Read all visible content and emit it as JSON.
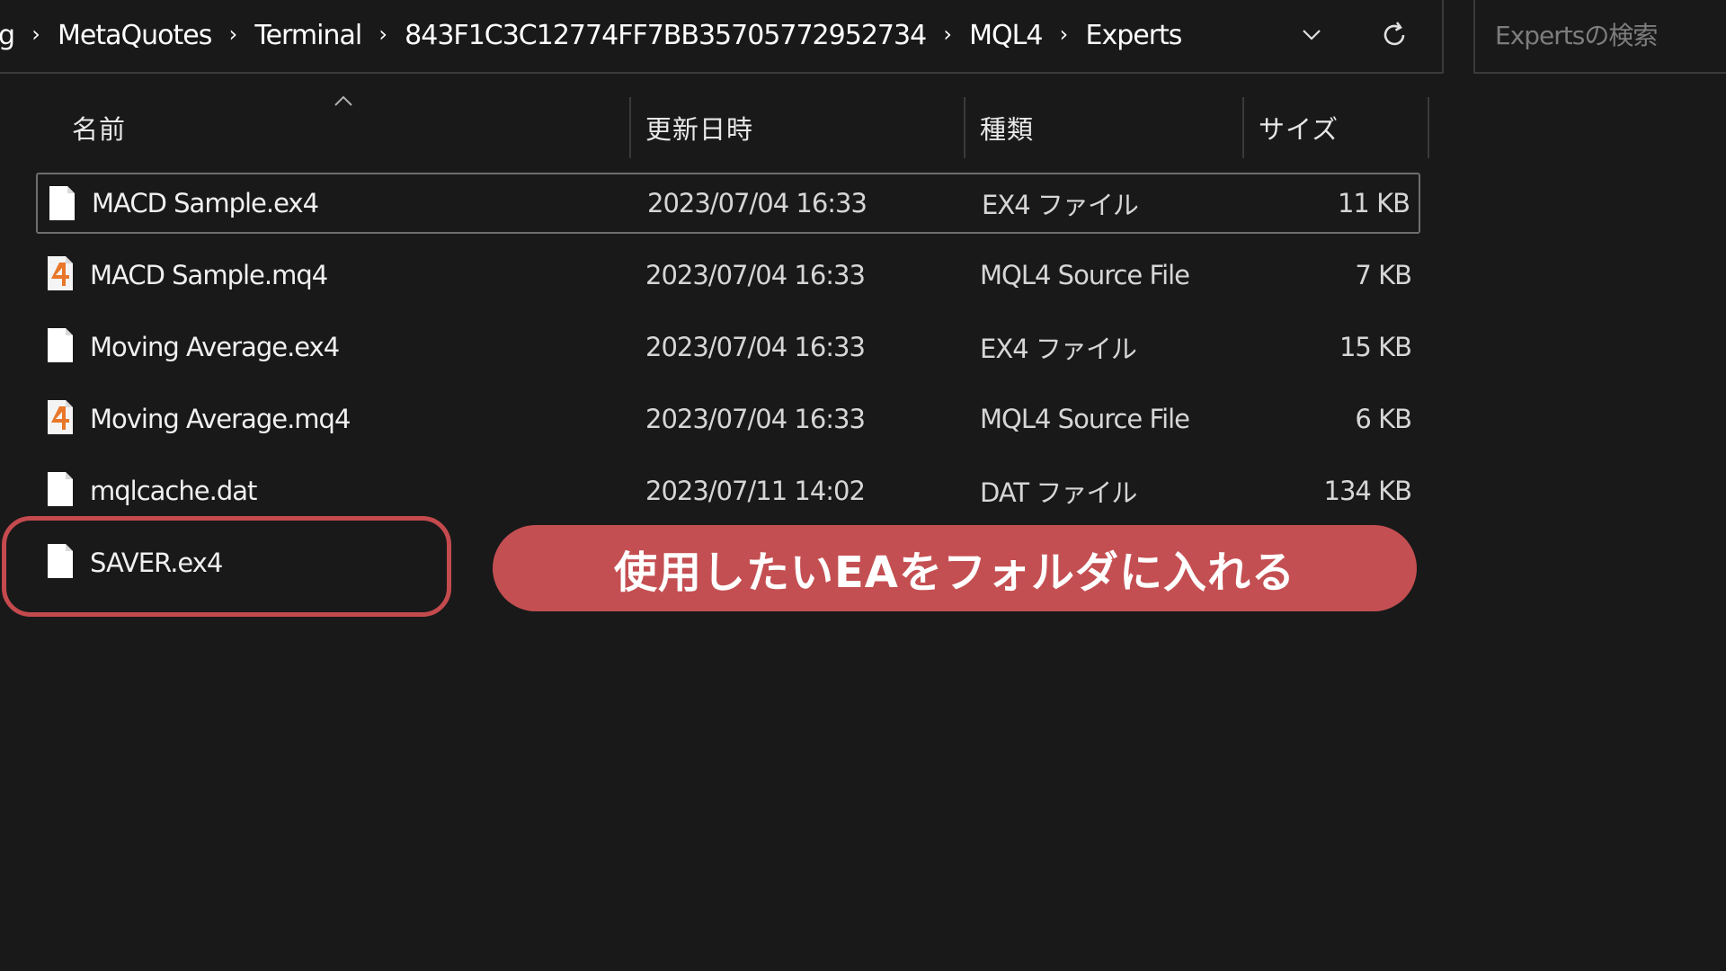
{
  "address_bar": {
    "crumbs": [
      "g",
      "MetaQuotes",
      "Terminal",
      "843F1C3C12774FF7BB35705772952734",
      "MQL4",
      "Experts"
    ],
    "separator": "›"
  },
  "search": {
    "placeholder": "Expertsの検索"
  },
  "columns": {
    "name": "名前",
    "date": "更新日時",
    "type": "種類",
    "size": "サイズ"
  },
  "files": [
    {
      "name": "MACD Sample.ex4",
      "date": "2023/07/04 16:33",
      "type": "EX4 ファイル",
      "size": "11 KB",
      "icon": "blank-file-icon"
    },
    {
      "name": "MACD Sample.mq4",
      "date": "2023/07/04 16:33",
      "type": "MQL4 Source File",
      "size": "7 KB",
      "icon": "mql4-file-icon"
    },
    {
      "name": "Moving Average.ex4",
      "date": "2023/07/04 16:33",
      "type": "EX4 ファイル",
      "size": "15 KB",
      "icon": "blank-file-icon"
    },
    {
      "name": "Moving Average.mq4",
      "date": "2023/07/04 16:33",
      "type": "MQL4 Source File",
      "size": "6 KB",
      "icon": "mql4-file-icon"
    },
    {
      "name": "mqlcache.dat",
      "date": "2023/07/11 14:02",
      "type": "DAT ファイル",
      "size": "134 KB",
      "icon": "blank-file-icon"
    },
    {
      "name": "SAVER.ex4",
      "date": "",
      "type": "",
      "size": "",
      "icon": "blank-file-icon"
    }
  ],
  "selected_file": "MACD Sample.ex4",
  "annotation": {
    "callout_text": "使用したいEAをフォルダに入れる",
    "highlighted_file": "SAVER.ex4",
    "color": "#c44f52"
  },
  "colors": {
    "background": "#191919",
    "mql4_icon_accent": "#e8772a"
  }
}
